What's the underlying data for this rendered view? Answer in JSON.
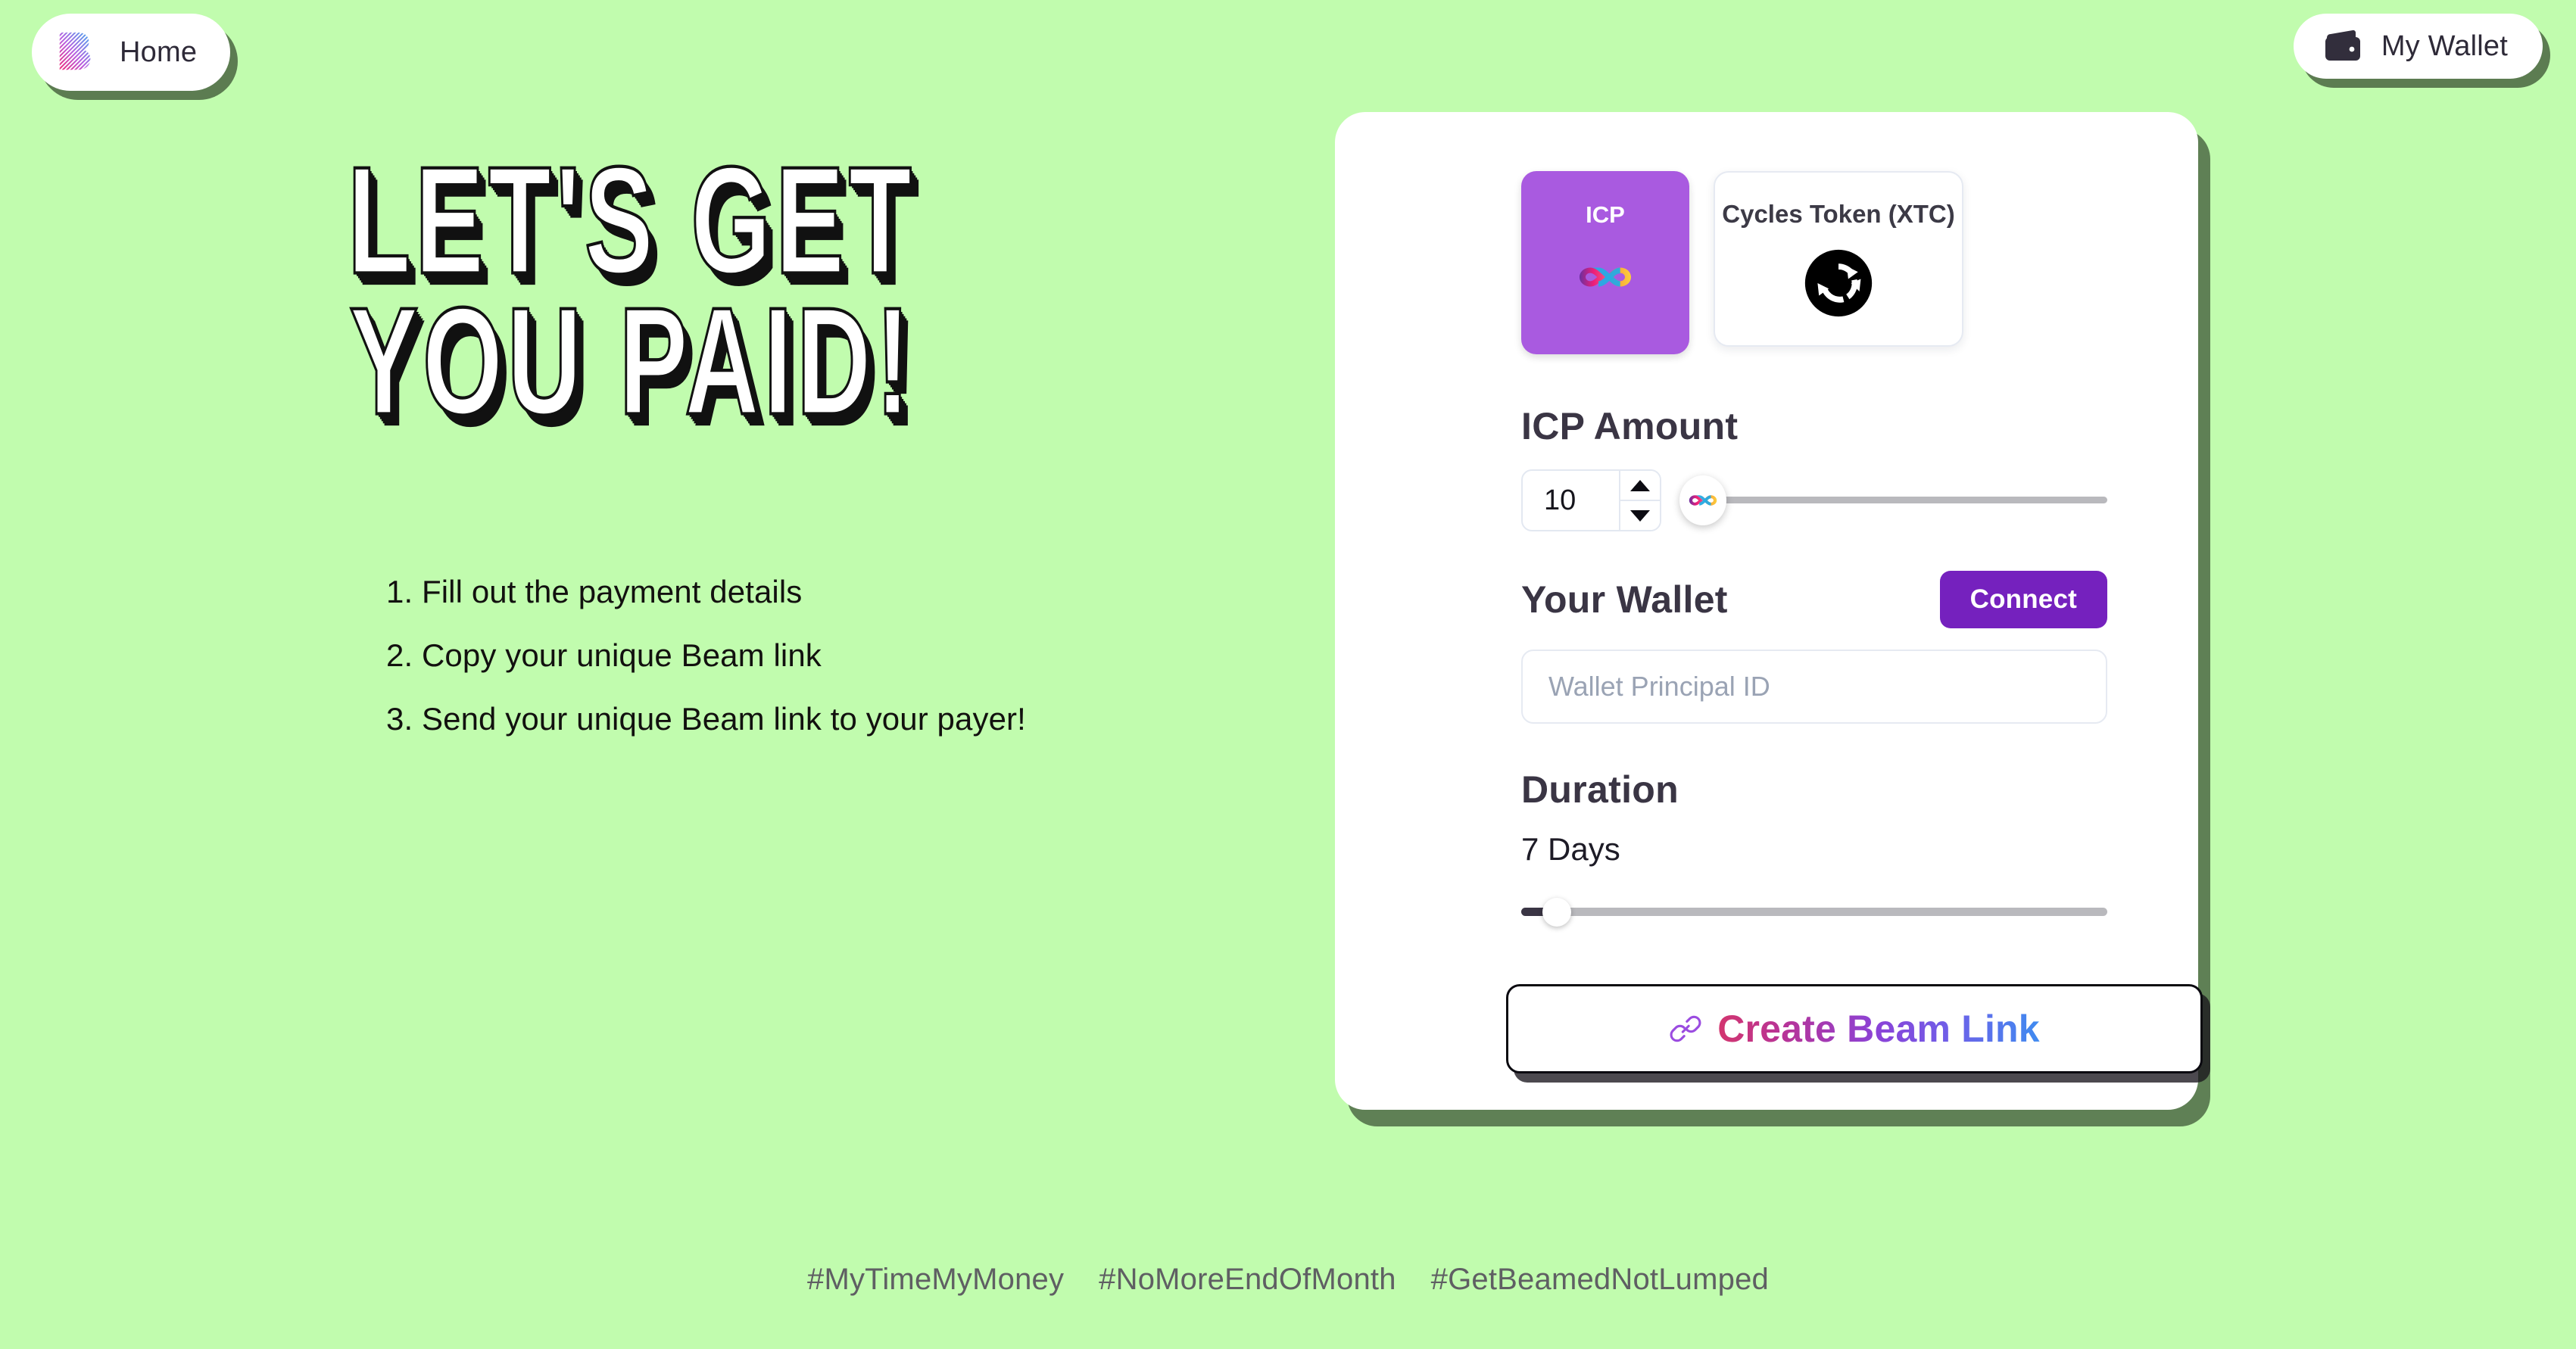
{
  "nav": {
    "home_label": "Home",
    "home_icon": "beam-b-logo-icon",
    "wallet_label": "My Wallet",
    "wallet_icon": "wallet-icon"
  },
  "hero": {
    "line1": "Let's get",
    "line2": "you paid!",
    "steps": [
      "1. Fill out the payment details",
      "2. Copy your unique Beam link",
      "3. Send your unique Beam link to your payer!"
    ]
  },
  "form": {
    "tokens": [
      {
        "name": "ICP",
        "icon": "icp-infinity-icon",
        "selected": true
      },
      {
        "name": "Cycles Token (XTC)",
        "icon": "xtc-cycles-icon",
        "selected": false
      }
    ],
    "amount": {
      "label": "ICP Amount",
      "value": "10",
      "slider_icon": "icp-infinity-icon",
      "slider_position_pct": 0
    },
    "wallet": {
      "label": "Your Wallet",
      "connect_label": "Connect",
      "input_value": "",
      "input_placeholder": "Wallet Principal ID"
    },
    "duration": {
      "label": "Duration",
      "value": "7 Days",
      "slider_position_pct": 3
    },
    "cta": {
      "label": "Create Beam Link",
      "icon": "chain-link-icon"
    }
  },
  "footer": {
    "tags": [
      "#MyTimeMyMoney",
      "#NoMoreEndOfMonth",
      "#GetBeamedNotLumped"
    ]
  },
  "colors": {
    "background": "#C1FCAE",
    "token_selected": "#A95AE0",
    "connect_button": "#7521BE",
    "heading_text": "#3A3544",
    "card_surface": "#FFFFFF"
  }
}
